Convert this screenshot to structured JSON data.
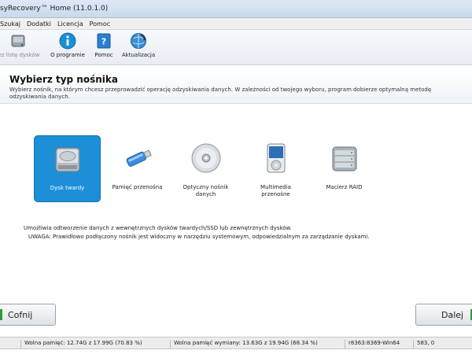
{
  "window": {
    "title": "syRecovery™ Home (11.0.1.0)"
  },
  "menu": {
    "items": [
      "Szukaj",
      "Dodatki",
      "Licencja",
      "Pomoc"
    ]
  },
  "toolbar": {
    "refresh_label": "iez listę dysków",
    "about_label": "O programie",
    "help_label": "Pomoc",
    "update_label": "Aktualizacja"
  },
  "header": {
    "title": "Wybierz typ nośnika",
    "description": "Wybierz nośnik, na którym chcesz przeprowadzić operację odzyskiwania danych. W zależności od twojego wyboru, program dobierze optymalną metodę odzyskiwania danych."
  },
  "media": [
    {
      "label": "Dysk twardy",
      "selected": true,
      "icon": "hard-disk-icon"
    },
    {
      "label": "Pamięć przenośna",
      "selected": false,
      "icon": "usb-flash-drive-icon"
    },
    {
      "label": "Optyczny nośnik danych",
      "selected": false,
      "icon": "optical-disc-icon"
    },
    {
      "label": "Multimedia przenośne",
      "selected": false,
      "icon": "media-player-icon"
    },
    {
      "label": "Macierz RAID",
      "selected": false,
      "icon": "raid-array-icon"
    }
  ],
  "info": {
    "line1": "Umożliwia odtworzenie danych z wewnętrznych dysków twardych/SSD lub zewnętrznych dysków.",
    "line2": "UWAGA: Prawidłowo podłączony nośnik jest widoczny w narzędziu systemowym, odpowiedzialnym za zarządzanie dyskami."
  },
  "buttons": {
    "back_label": "Cofnij",
    "next_label": "Dalej"
  },
  "statusbar": {
    "free_memory": "Wolna pamięć: 12.74G z 17.99G (70.83 %)",
    "free_swap": "Wolna pamięć wymiany: 13.63G z 19.94G (68.34 %)",
    "build": "r8363:8369-Win64",
    "coords": "583, 0"
  },
  "colors": {
    "accent": "#1c8fd8",
    "go_arrow": "#2f9a3a"
  }
}
